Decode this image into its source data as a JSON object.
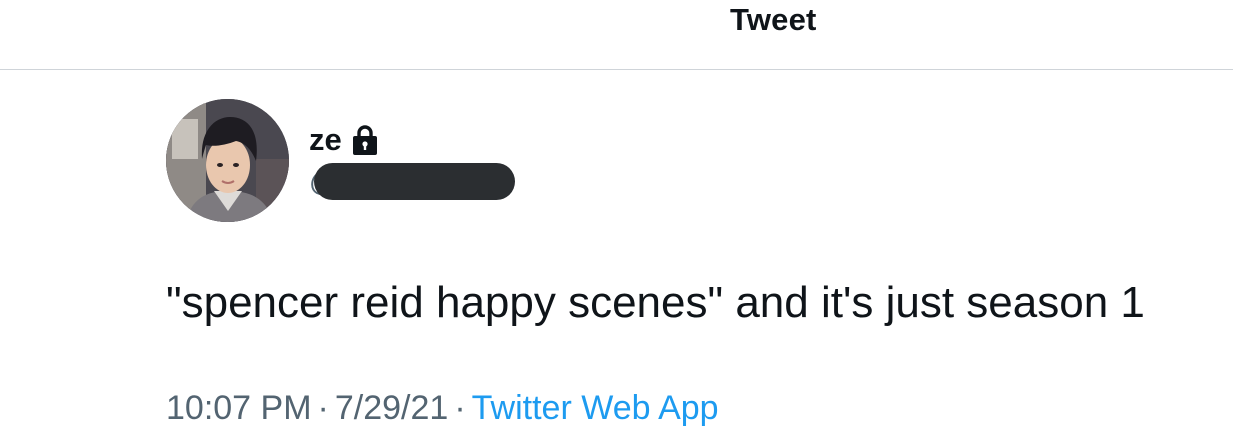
{
  "header": {
    "title": "Tweet"
  },
  "author": {
    "display_name": "ze",
    "handle": "@",
    "protected_icon": "lock-icon",
    "avatar_icon": "avatar"
  },
  "tweet": {
    "text": "\"spencer reid happy scenes\" and it's just season 1"
  },
  "meta": {
    "time": "10:07 PM",
    "separator": "·",
    "date": "7/29/21",
    "source": "Twitter Web App"
  },
  "colors": {
    "text_primary": "#0f1419",
    "text_secondary": "#536471",
    "link": "#1d9bf0",
    "divider": "#cfd4d9",
    "redaction": "#2b2e31"
  }
}
